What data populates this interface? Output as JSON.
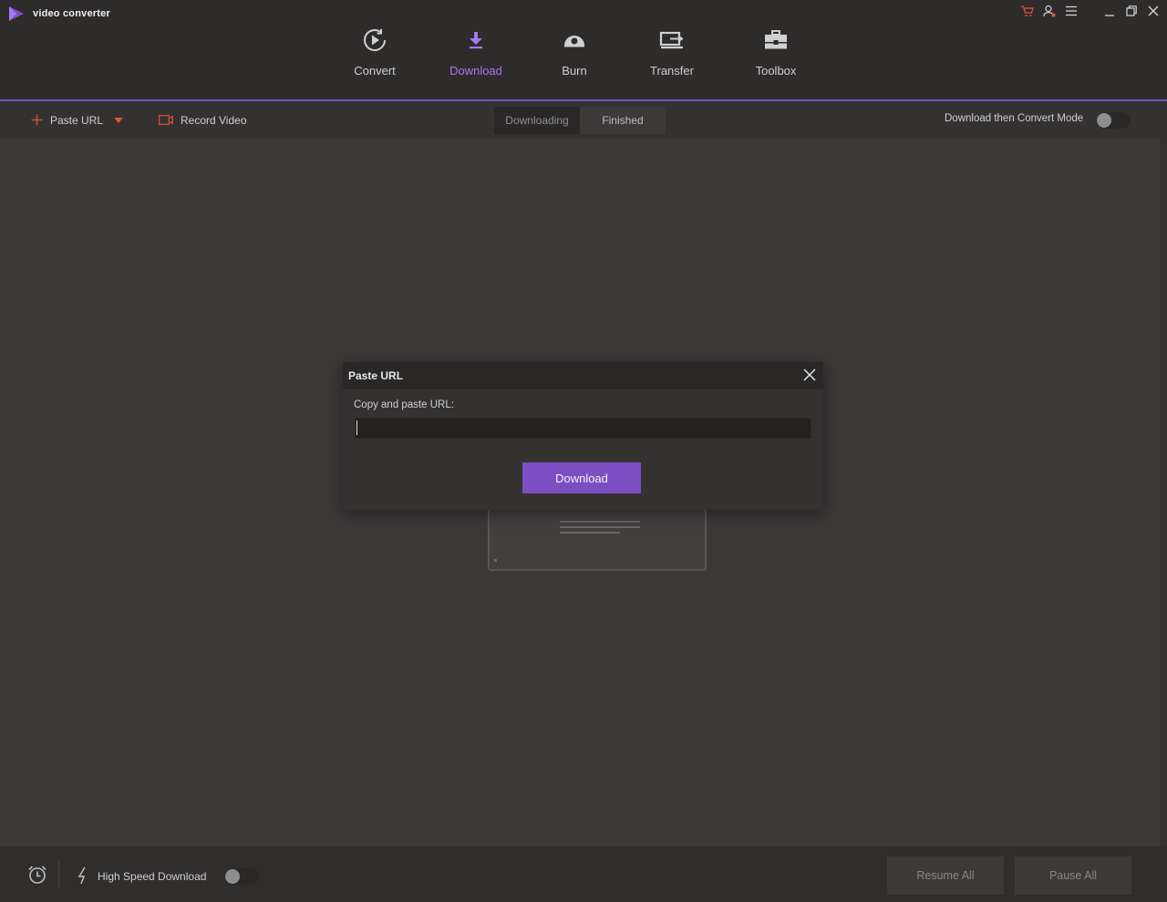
{
  "app": {
    "name": "video converter",
    "colors": {
      "accent": "#8a5ed6",
      "button": "#7d4ec2",
      "highlight": "#e0523a"
    }
  },
  "window_controls": [
    "cart-icon",
    "user-icon",
    "menu-icon",
    "minimize-icon",
    "maximize-icon",
    "close-icon"
  ],
  "nav": {
    "active": "Download",
    "items": [
      {
        "label": "Convert",
        "icon": "convert-play-icon"
      },
      {
        "label": "Download",
        "icon": "download-arrow-icon"
      },
      {
        "label": "Burn",
        "icon": "disc-burn-icon"
      },
      {
        "label": "Transfer",
        "icon": "transfer-device-icon"
      },
      {
        "label": "Toolbox",
        "icon": "toolbox-icon"
      }
    ]
  },
  "toolbar": {
    "paste_url": "Paste URL",
    "record_video": "Record Video",
    "tabs": [
      {
        "label": "Downloading",
        "active": true
      },
      {
        "label": "Finished",
        "active": false
      }
    ],
    "mode_label": "Download then Convert Mode",
    "mode_on": false
  },
  "dialog": {
    "title": "Paste URL",
    "label": "Copy and paste URL:",
    "input_value": "",
    "download_button": "Download"
  },
  "footer": {
    "high_speed_label": "High Speed Download",
    "high_speed_on": false,
    "resume_all": "Resume All",
    "pause_all": "Pause All"
  }
}
